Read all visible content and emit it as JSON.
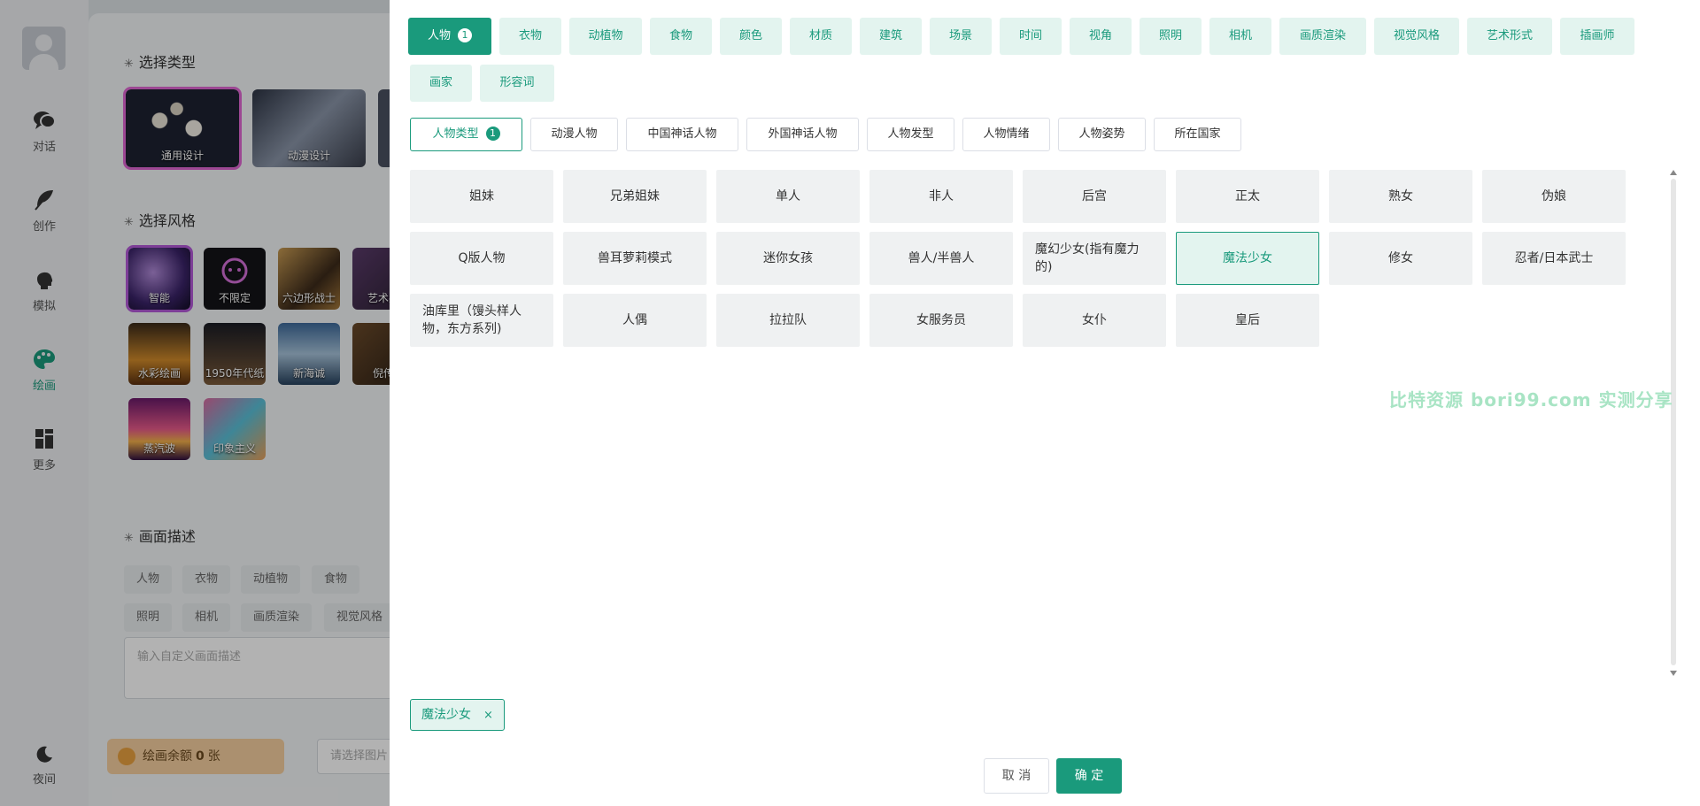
{
  "nav": {
    "items": [
      {
        "label": "对话",
        "icon": "chat-icon"
      },
      {
        "label": "创作",
        "icon": "feather-icon"
      },
      {
        "label": "模拟",
        "icon": "head-icon"
      },
      {
        "label": "绘画",
        "icon": "palette-icon"
      },
      {
        "label": "更多",
        "icon": "grid-icon"
      }
    ],
    "night_label": "夜间"
  },
  "bg": {
    "type_title": "选择类型",
    "type_cards": [
      "通用设计",
      "动漫设计"
    ],
    "style_title": "选择风格",
    "style_cards": [
      "智能",
      "不限定",
      "六边形战士",
      "艺术感",
      "水彩绘画",
      "1950年代纸",
      "新海诚",
      "倪传",
      "蒸汽波",
      "印象主义"
    ],
    "desc_title": "画面描述",
    "desc_chips_row1": [
      "人物",
      "衣物",
      "动植物",
      "食物"
    ],
    "desc_chips_row2": [
      "照明",
      "相机",
      "画质渲染",
      "视觉风格"
    ],
    "desc_placeholder": "输入自定义画面描述",
    "quota_label": "绘画余额",
    "quota_value": "0",
    "quota_unit": "张",
    "image_placeholder": "请选择图片"
  },
  "categories": [
    "人物",
    "衣物",
    "动植物",
    "食物",
    "颜色",
    "材质",
    "建筑",
    "场景",
    "时间",
    "视角",
    "照明",
    "相机",
    "画质渲染",
    "视觉风格",
    "艺术形式",
    "插画师",
    "画家",
    "形容词"
  ],
  "category_badge": "1",
  "subcategories": [
    "人物类型",
    "动漫人物",
    "中国神话人物",
    "外国神话人物",
    "人物发型",
    "人物情绪",
    "人物姿势",
    "所在国家"
  ],
  "subcategory_badge": "1",
  "options": [
    "姐妹",
    "兄弟姐妹",
    "单人",
    "非人",
    "后宫",
    "正太",
    "熟女",
    "伪娘",
    "Q版人物",
    "兽耳萝莉模式",
    "迷你女孩",
    "兽人/半兽人",
    "魔幻少女(指有魔力的)",
    "魔法少女",
    "修女",
    "忍者/日本武士",
    "油库里（馒头样人物，东方系列)",
    "人偶",
    "拉拉队",
    "女服务员",
    "女仆",
    "皇后"
  ],
  "selected_option": "魔法少女",
  "watermark": "比特资源 bori99.com 实测分享",
  "selected_tag": {
    "label": "魔法少女",
    "close": "×"
  },
  "buttons": {
    "cancel": "取 消",
    "confirm": "确 定"
  },
  "colors": {
    "accent": "#1a9a7c",
    "accent_light": "#e3f4ef"
  }
}
